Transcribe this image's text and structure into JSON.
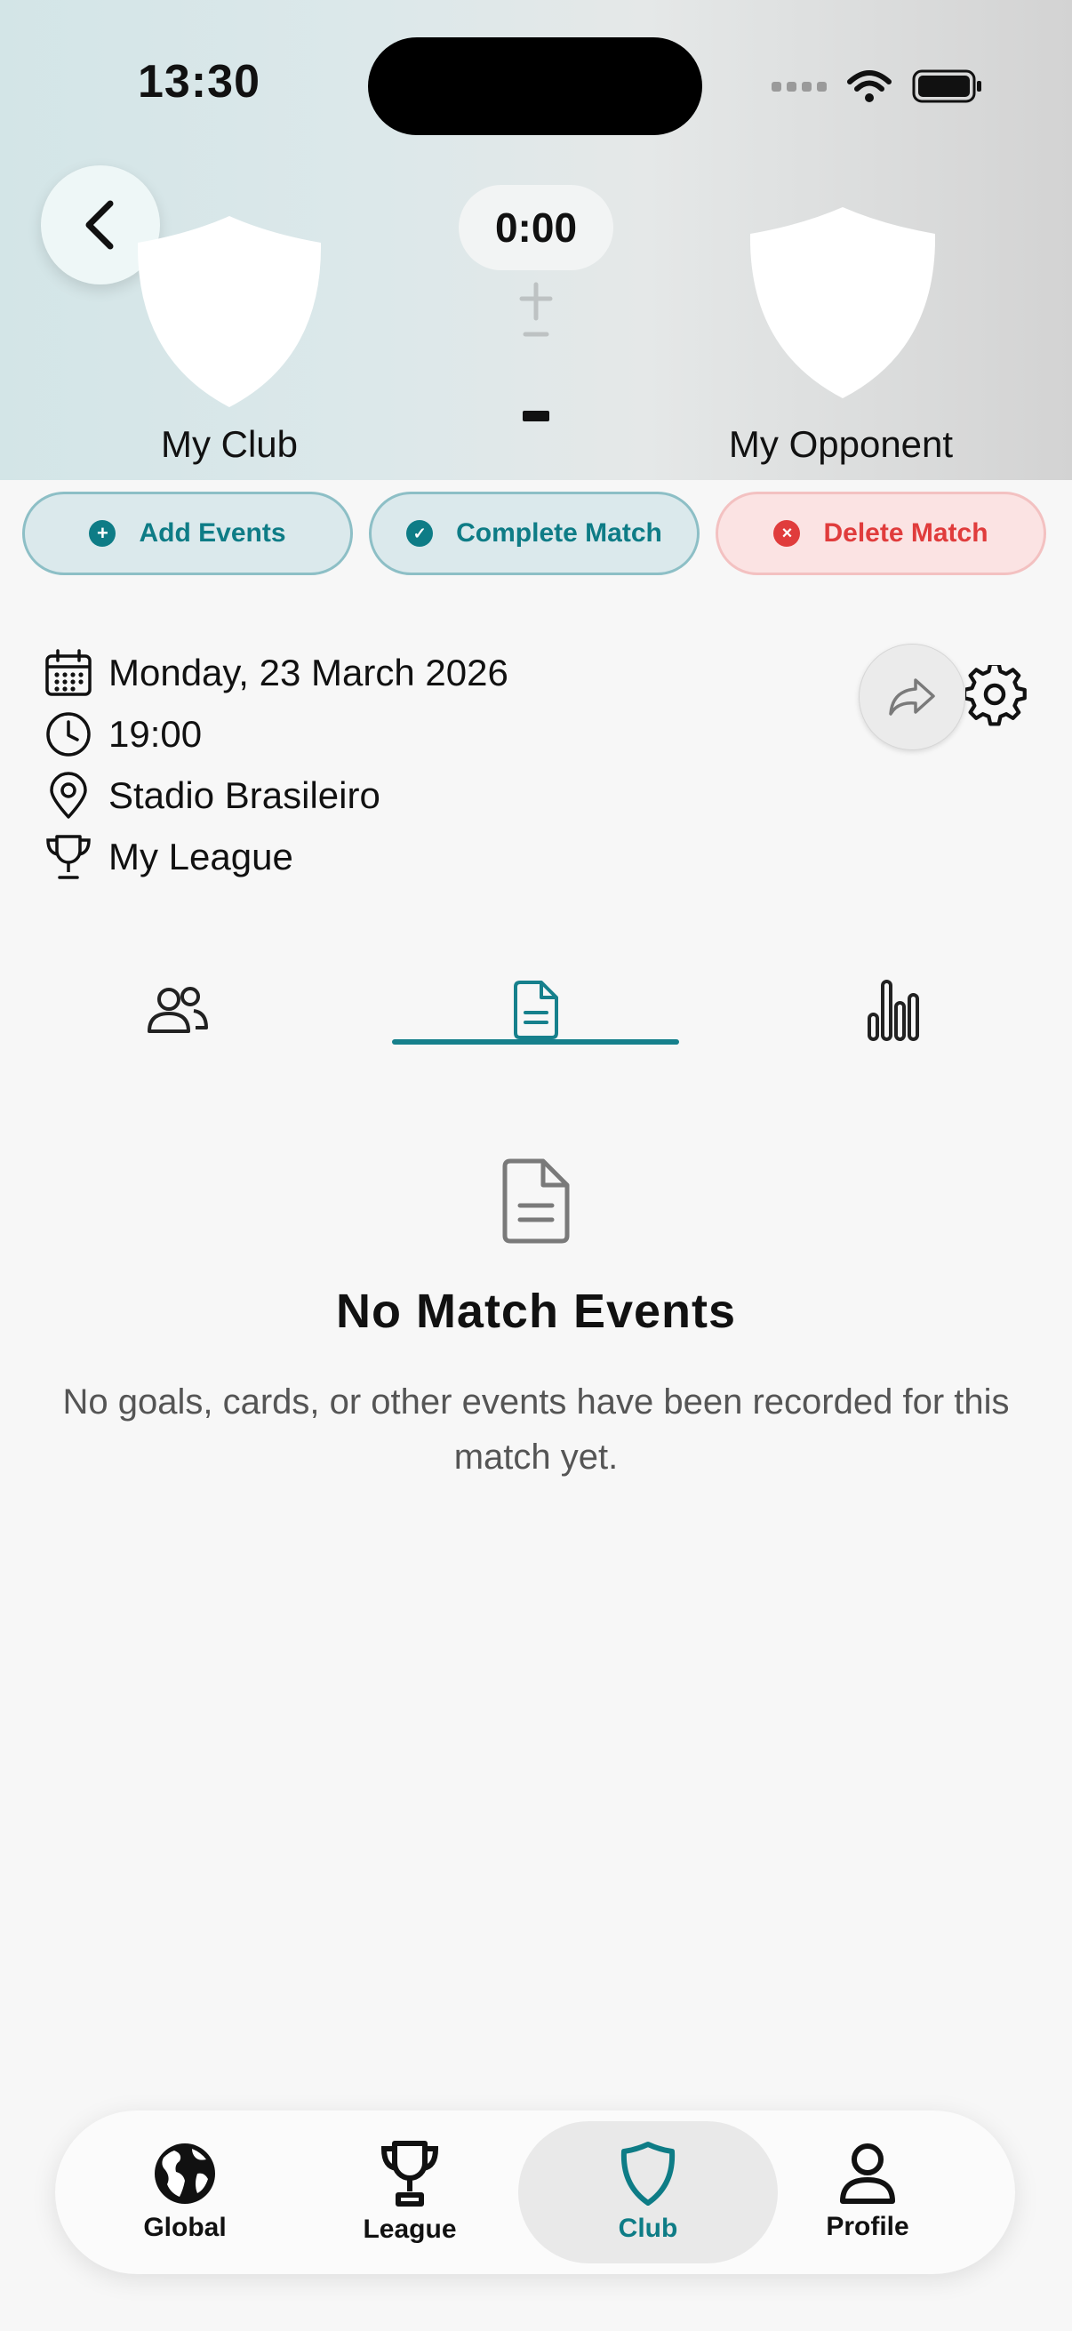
{
  "status_bar": {
    "time": "13:30"
  },
  "match": {
    "score": "0:00",
    "score_separator": "-",
    "home_team": "My Club",
    "away_team": "My Opponent"
  },
  "actions": {
    "add_events": "Add Events",
    "complete_match": "Complete Match",
    "delete_match": "Delete Match"
  },
  "info": {
    "date": "Monday, 23 March 2026",
    "time": "19:00",
    "venue": "Stadio Brasileiro",
    "league": "My League"
  },
  "tabs": [
    {
      "icon": "people-icon",
      "selected": false
    },
    {
      "icon": "document-icon",
      "selected": true
    },
    {
      "icon": "bar-chart-icon",
      "selected": false
    }
  ],
  "empty_state": {
    "title": "No Match Events",
    "description": "No goals, cards, or other events have been recorded for this match yet."
  },
  "bottom_nav": {
    "items": [
      {
        "label": "Global",
        "icon": "globe-icon",
        "active": false
      },
      {
        "label": "League",
        "icon": "trophy-icon",
        "active": false
      },
      {
        "label": "Club",
        "icon": "shield-icon",
        "active": true
      },
      {
        "label": "Profile",
        "icon": "person-icon",
        "active": false
      }
    ]
  },
  "colors": {
    "accent": "#0e7c86",
    "danger": "#e03c3c",
    "background": "#f7f7f7"
  }
}
